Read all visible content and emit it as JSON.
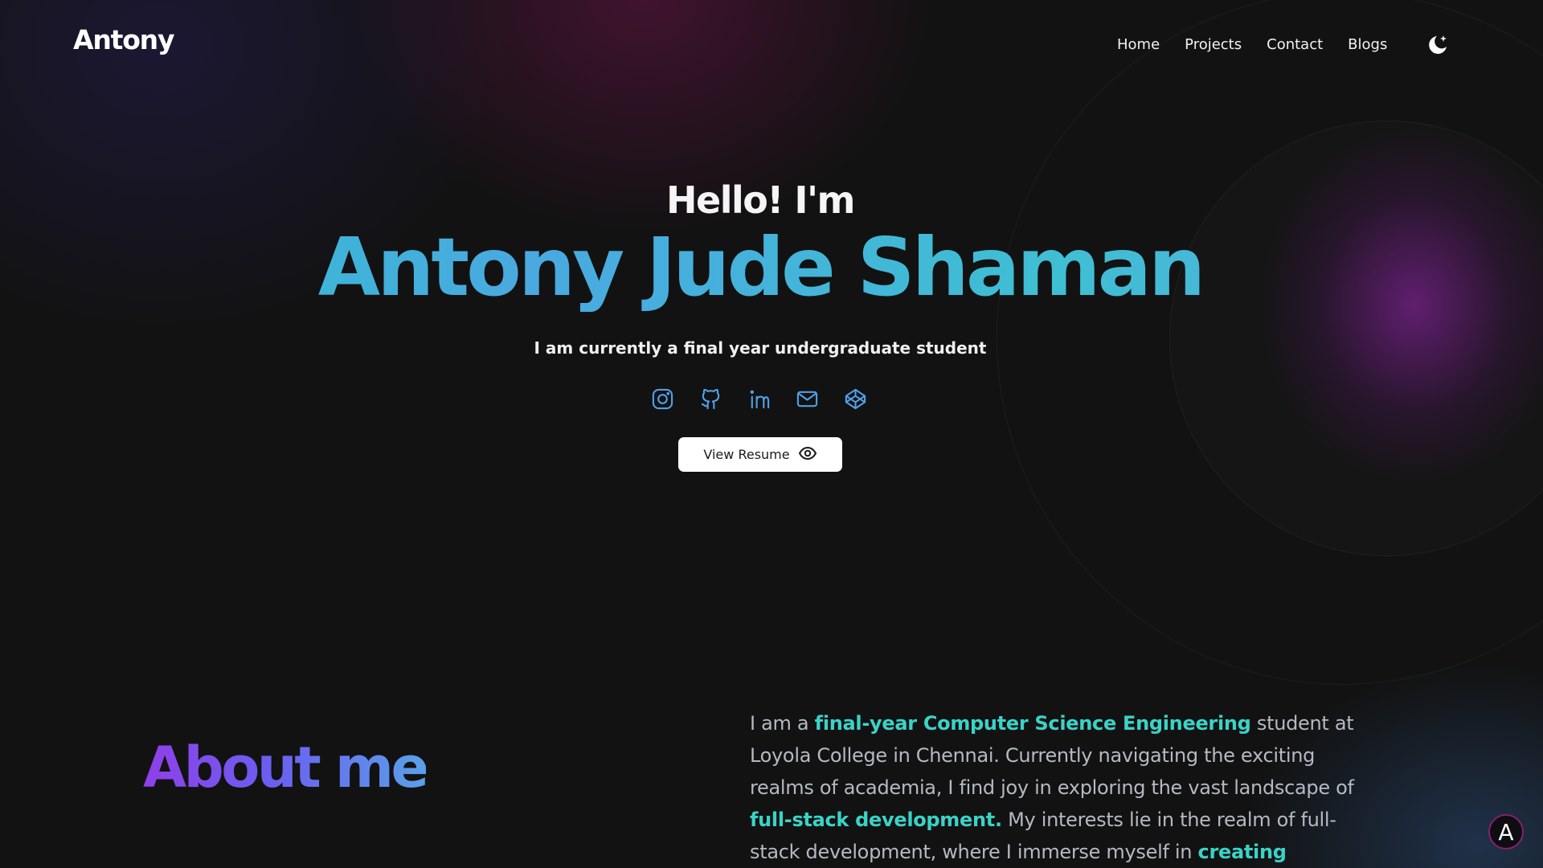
{
  "header": {
    "logo": "Antony",
    "nav": [
      {
        "label": "Home"
      },
      {
        "label": "Projects"
      },
      {
        "label": "Contact"
      },
      {
        "label": "Blogs"
      }
    ],
    "theme_icon": "moon-stars-icon"
  },
  "hero": {
    "greeting": "Hello! I'm",
    "name": "Antony Jude Shaman",
    "subtitle": "I am currently a final year undergraduate student",
    "socials": [
      {
        "icon": "instagram-icon"
      },
      {
        "icon": "github-icon"
      },
      {
        "icon": "linkedin-icon"
      },
      {
        "icon": "mail-icon"
      },
      {
        "icon": "codepen-icon"
      }
    ],
    "resume_label": "View Resume",
    "resume_icon": "eye-icon"
  },
  "about": {
    "title": "About me",
    "parts": [
      {
        "text": "I am a ",
        "highlight": false
      },
      {
        "text": "final-year Computer Science Engineering",
        "highlight": true
      },
      {
        "text": " student at Loyola College in Chennai. Currently navigating the exciting realms of academia, I find joy in exploring the vast landscape of ",
        "highlight": false
      },
      {
        "text": "full-stack development.",
        "highlight": true
      },
      {
        "text": " My interests lie in the realm of full-stack development, where I immerse myself in ",
        "highlight": false
      },
      {
        "text": "creating seamless web experiences.",
        "highlight": true
      }
    ]
  },
  "floating_badge": {
    "label": "A"
  },
  "colors": {
    "background": "#121212",
    "accent_teal": "#3ad3c7",
    "accent_blue": "#49a9e0",
    "accent_purple": "#8f3fe8",
    "icon_blue": "#4f9fe6"
  }
}
